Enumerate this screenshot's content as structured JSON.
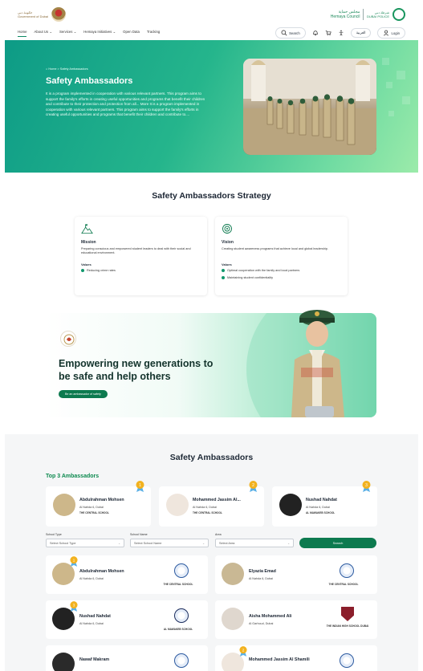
{
  "header": {
    "logo_left_text": "حكومة دبي\nGovernment of Dubai",
    "logo_right_text_ar": "مجلس حماية",
    "logo_right_text_en": "Hemaya Council",
    "dubai_police_text": "شرطة دبي\nDUBAI POLICE",
    "nav": [
      "Home",
      "About Us ⌄",
      "Services ⌄",
      "Hemaya Initiatives ⌄",
      "Open Data",
      "Tracking"
    ],
    "search_label": "Search",
    "lang_label": "العربية",
    "login_label": "Login"
  },
  "hero": {
    "breadcrumb": "⌂ Home  >  Safety Ambassadors",
    "title": "Safety Ambassadors",
    "description": "It is a program implemented in cooperation with various relevant partners. This program aims to support the family's efforts in creating useful opportunities and programs that benefit their children and contribute to their protection and protection from all... More It is a program implemented in cooperation with various relevant partners. This program aims to support the family's efforts in creating useful opportunities and programs that benefit their children and contribute to...."
  },
  "strategy": {
    "title": "Safety Ambassadors Strategy",
    "mission": {
      "title": "Mission",
      "text": "Preparing conscious and empowered student leaders to deal with their social and educational environment.",
      "values_label": "Values",
      "values": [
        "Reducing crime rates"
      ]
    },
    "vision": {
      "title": "Vision",
      "text": "Creating student awareness programs that achieve local and global leadership.",
      "values_label": "Values",
      "values": [
        "Optimal cooperation with the family and local partners",
        "Maintaining student confidentiality"
      ]
    }
  },
  "promo": {
    "title_line1": "Empowering new generations to",
    "title_line2": "be safe and help others",
    "button": "Be an ambassador of safety"
  },
  "ambassadors": {
    "title": "Safety Ambassadors",
    "top3_label": "Top 3 Ambassadors",
    "top3": [
      {
        "name": "Abdulrahman Mohsen",
        "location": "Al Nahda 6, Dubai",
        "school": "THE CENTRAL SCHOOL",
        "rank": "1"
      },
      {
        "name": "Mohammed Jassim Al...",
        "location": "Al Nahda 6, Dubai",
        "school": "THE CENTRAL SCHOOL",
        "rank": "2"
      },
      {
        "name": "Nushad Nahdat",
        "location": "Al Nahda 6, Dubai",
        "school": "AL MAWAKEB SCHOOL",
        "rank": "3"
      }
    ],
    "filters": {
      "school_type_label": "School Type",
      "school_type_value": "Select School Type",
      "school_name_label": "School Name",
      "school_name_value": "Select School Name",
      "area_label": "Area",
      "area_value": "Select Area",
      "search_label": "Search"
    },
    "list": [
      {
        "name": "Abdulrahman Mohsen",
        "location": "Al Nahda 6, Dubai",
        "school": "THE CENTRAL SCHOOL",
        "rank": "1"
      },
      {
        "name": "Elyazia Emad",
        "location": "Al Nahda 6, Dubai",
        "school": "THE CENTRAL SCHOOL",
        "rank": ""
      },
      {
        "name": "Nushad Nahdat",
        "location": "Al Nahda 6, Dubai",
        "school": "AL MAWAKEB SCHOOL",
        "rank": "3"
      },
      {
        "name": "Aisha Mohammed Ali",
        "location": "Al Garhoud, Dubai",
        "school": "THE INDIAN HIGH SCHOOL DUBAI",
        "rank": ""
      },
      {
        "name": "Nawaf Makram",
        "location": "",
        "school": "",
        "rank": ""
      },
      {
        "name": "Mohammed Jassim Al Shamili",
        "location": "",
        "school": "",
        "rank": "2"
      }
    ]
  },
  "colors": {
    "primary": "#0d7a4f",
    "accent": "#25b58c",
    "gold": "#f2b21f"
  }
}
